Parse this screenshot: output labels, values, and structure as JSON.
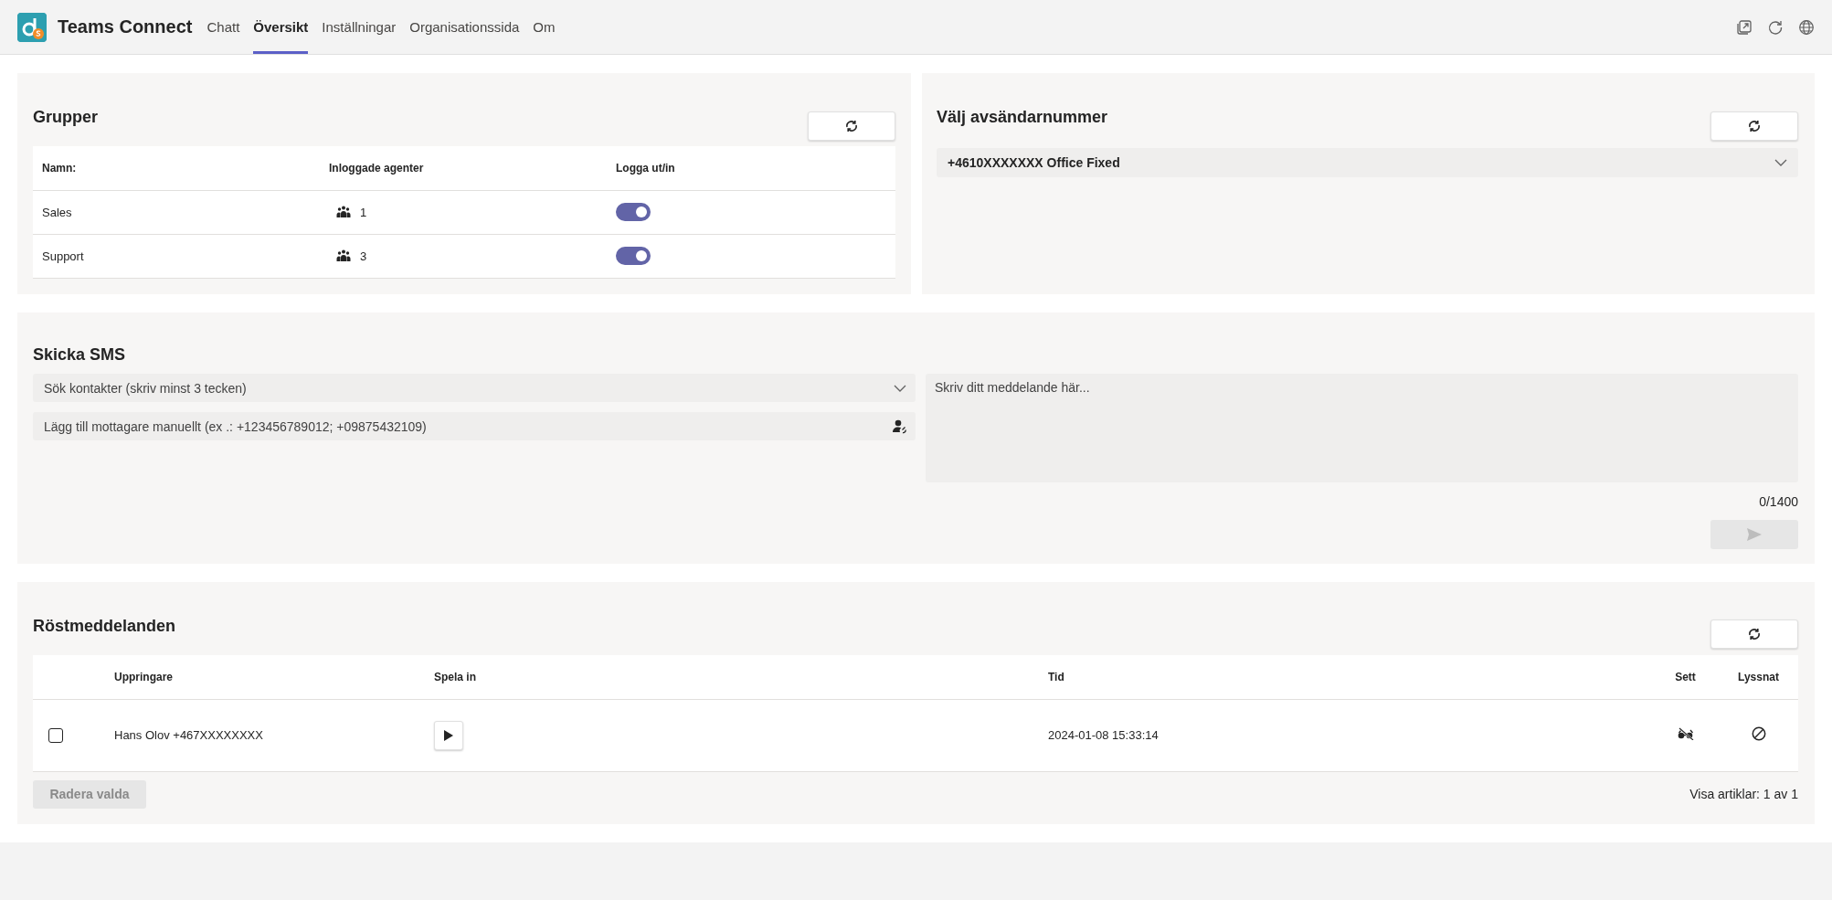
{
  "header": {
    "app_title": "Teams Connect",
    "tabs": [
      {
        "label": "Chatt",
        "selected": false
      },
      {
        "label": "Översikt",
        "selected": true
      },
      {
        "label": "Inställningar",
        "selected": false
      },
      {
        "label": "Organisationssida",
        "selected": false
      },
      {
        "label": "Om",
        "selected": false
      }
    ]
  },
  "groups": {
    "title": "Grupper",
    "columns": [
      "Namn:",
      "Inloggade agenter",
      "Logga ut/in"
    ],
    "rows": [
      {
        "name": "Sales",
        "agents": "1",
        "logged_in": true
      },
      {
        "name": "Support",
        "agents": "3",
        "logged_in": true
      }
    ]
  },
  "sender": {
    "title": "Välj avsändarnummer",
    "selected_number": "+4610XXXXXXX Office Fixed"
  },
  "sms": {
    "title": "Skicka SMS",
    "contact_search": {
      "placeholder": "Sök kontakter (skriv minst 3 tecken)"
    },
    "recipients": {
      "placeholder": "Lägg till mottagare manuellt (ex .: +123456789012; +09875432109)"
    },
    "message": {
      "placeholder": "Skriv ditt meddelande här..."
    },
    "counter": "0/1400",
    "send_button": {
      "disabled": true
    }
  },
  "voicemail": {
    "title": "Röstmeddelanden",
    "columns": [
      "Uppringare",
      "Spela in",
      "Tid",
      "Sett",
      "Lyssnat"
    ],
    "rows": [
      {
        "checked": false,
        "caller": "Hans Olov +467XXXXXXXX",
        "time": "2024-01-08 15:33:14",
        "seen": false,
        "listened": false
      }
    ],
    "delete_button": {
      "label": "Radera valda",
      "disabled": true
    },
    "pager": "Visa artiklar: 1 av 1"
  }
}
